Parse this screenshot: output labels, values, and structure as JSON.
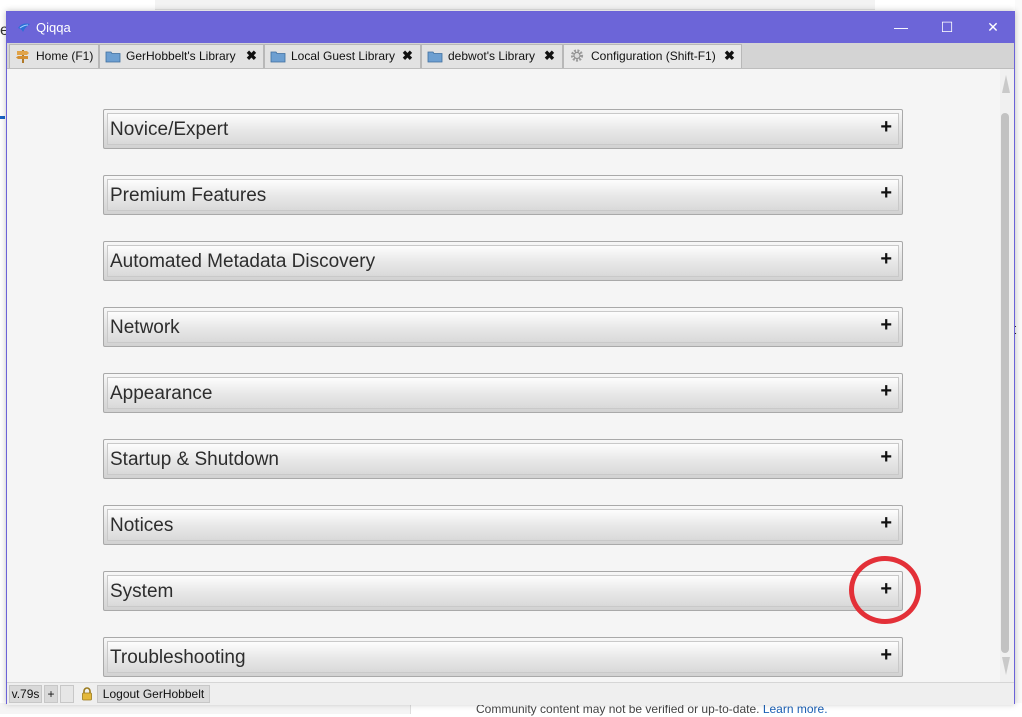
{
  "window": {
    "title": "Qiqqa"
  },
  "window_controls": {
    "minimize": "—",
    "maximize": "☐",
    "close": "✕"
  },
  "tabs": [
    {
      "label": "Home (F1)",
      "icon": "home-signpost-icon",
      "closable": false
    },
    {
      "label": "GerHobbelt's Library",
      "icon": "folder-icon",
      "closable": true
    },
    {
      "label": "Local Guest Library",
      "icon": "folder-icon",
      "closable": true
    },
    {
      "label": "debwot's Library",
      "icon": "folder-icon",
      "closable": true
    },
    {
      "label": "Configuration (Shift-F1)",
      "icon": "gear-icon",
      "closable": true
    }
  ],
  "tab_close_glyph": "✖",
  "sections": [
    {
      "title": "Novice/Expert",
      "expand_glyph": "+"
    },
    {
      "title": "Premium Features",
      "expand_glyph": "+"
    },
    {
      "title": "Automated Metadata Discovery",
      "expand_glyph": "+"
    },
    {
      "title": "Network",
      "expand_glyph": "+"
    },
    {
      "title": "Appearance",
      "expand_glyph": "+"
    },
    {
      "title": "Startup & Shutdown",
      "expand_glyph": "+"
    },
    {
      "title": "Notices",
      "expand_glyph": "+"
    },
    {
      "title": "System",
      "expand_glyph": "+"
    },
    {
      "title": "Troubleshooting",
      "expand_glyph": "+"
    }
  ],
  "statusbar": {
    "version": "v.79s",
    "plus": "+",
    "logout_label": "Logout GerHobbelt"
  },
  "background": {
    "community_text": "Community content may not be verified or up-to-date.",
    "learn_more": "Learn more."
  },
  "colors": {
    "titlebar": "#6c65d8",
    "annotation_circle": "#e33038",
    "link": "#1a5fb4"
  }
}
